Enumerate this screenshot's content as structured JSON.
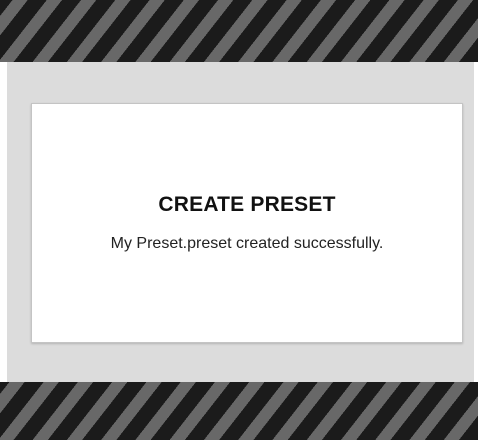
{
  "dialog": {
    "title": "CREATE PRESET",
    "message": "My Preset.preset created successfully."
  },
  "colors": {
    "stripe_dark": "#1b1b1b",
    "stripe_light": "#686868",
    "panel_background": "#dcdcdc",
    "dialog_background": "#ffffff"
  }
}
